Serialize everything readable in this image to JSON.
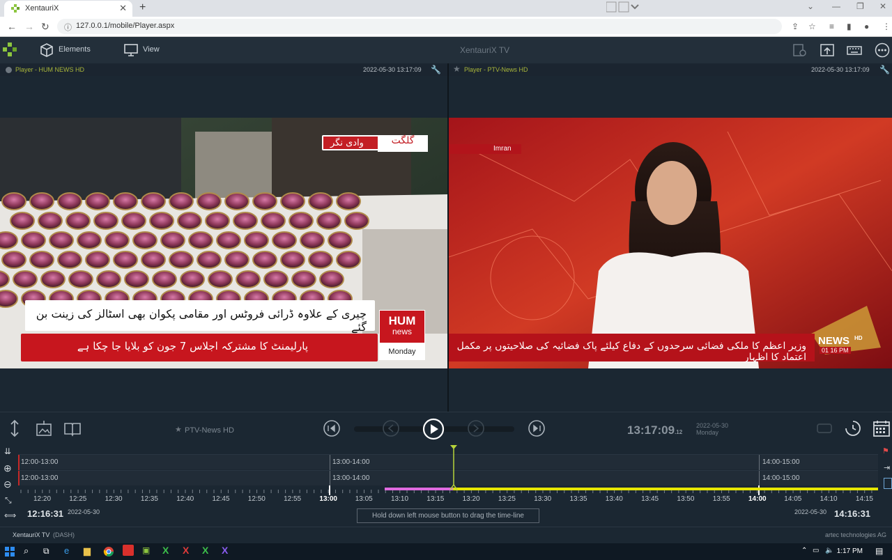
{
  "browser": {
    "tab_title": "XentauriX",
    "close_tab": "✕",
    "new_tab": "+",
    "url": "127.0.0.1/mobile/Player.aspx"
  },
  "app": {
    "title": "XentauriX TV",
    "menu_elements": "Elements",
    "menu_view": "View"
  },
  "players": [
    {
      "name": "Player - HUM NEWS HD",
      "timestamp": "2022-05-30 13:17:09",
      "ticker_line1": "چیری کے علاوہ ڈرائی فروٹس اور مقامی پکوان بھی اسٹالز کی زینت بن گئے",
      "ticker_line2": "پارلیمنٹ کا مشترکہ اجلاس 7 جون کو بلایا جا چکا ہے",
      "location_tag1": "گلگت",
      "location_tag2": "وادی نگر",
      "logo_top": "HUM",
      "logo_bottom": "news",
      "day": "Monday",
      "dot_color": "#6e7780"
    },
    {
      "name": "Player - PTV-News HD",
      "timestamp": "2022-05-30 13:17:09",
      "ticker_line1": "وزیر اعظم کا ملکی فضائی سرحدوں کے دفاع کیلئے پاک فضائیہ کی صلاحیتوں پر مکمل اعتماد کا اظہار",
      "logo": "NEWS",
      "logo_hd": "HD",
      "logo_time": "01 16 PM",
      "program_tag": "Imran",
      "dot_color": "#6e7780"
    }
  ],
  "controls": {
    "selected_channel": "PTV-News HD",
    "clock_main": "13:17:09",
    "clock_frac": ".12",
    "clock_date": "2022-05-30",
    "clock_day": "Monday"
  },
  "timeline": {
    "row1_segments": [
      "12:00-13:00",
      "13:00-14:00",
      "14:00-15:00"
    ],
    "row2_segments": [
      "12:00-13:00",
      "13:00-14:00",
      "14:00-15:00"
    ],
    "ticks": [
      "12:20",
      "12:25",
      "12:30",
      "12:35",
      "12:40",
      "12:45",
      "12:50",
      "12:55",
      "13:00",
      "13:05",
      "13:10",
      "13:15",
      "13:20",
      "13:25",
      "13:30",
      "13:35",
      "13:40",
      "13:45",
      "13:50",
      "13:55",
      "14:00",
      "14:05",
      "14:10",
      "14:15"
    ],
    "start_time": "12:16:31",
    "start_date": "2022-05-30",
    "end_time": "14:16:31",
    "end_date": "2022-05-30",
    "hint": "Hold down left mouse button to drag the time-line"
  },
  "footer": {
    "left": "XentauriX TV",
    "left_sub": "(DASH)",
    "right": "artec technologies AG"
  },
  "taskbar": {
    "time": "1:17 PM"
  },
  "colors": {
    "accent_green": "#8dc63f",
    "played_pink": "#e06be0",
    "recorded_yellow": "#e6e600",
    "playhead": "#b7d43a"
  }
}
